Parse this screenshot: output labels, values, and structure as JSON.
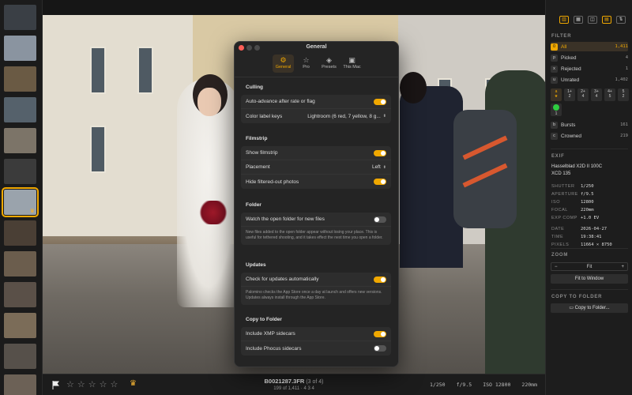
{
  "filmstrip": {
    "thumbs": [
      {
        "color": "#3a3f45"
      },
      {
        "color": "#8a94a0"
      },
      {
        "color": "#6a5a44"
      },
      {
        "color": "#55616b"
      },
      {
        "color": "#7c7468"
      },
      {
        "color": "#3b3b3b"
      },
      {
        "color": "#9aa3ac",
        "selected": true
      },
      {
        "color": "#4a3f35"
      },
      {
        "color": "#6b5d4d"
      },
      {
        "color": "#5a5048"
      },
      {
        "color": "#7b6c58"
      },
      {
        "color": "#56504a"
      },
      {
        "color": "#6c6156"
      }
    ]
  },
  "bottombar": {
    "filename": "B0021287.3FR",
    "position": "(3 of 4)",
    "count": "199 of 1,411",
    "counts_detail": "4   3   4",
    "shutter": "1/250",
    "aperture": "f/9.5",
    "iso": "ISO 12800",
    "focal": "220mm"
  },
  "sidebar": {
    "filter_title": "FILTER",
    "filters": [
      {
        "key": "0",
        "label": "All",
        "count": "1,411",
        "active": true
      },
      {
        "key": "p",
        "label": "Picked",
        "count": "4"
      },
      {
        "key": "x",
        "label": "Rejected",
        "count": "1"
      },
      {
        "key": "u",
        "label": "Unrated",
        "count": "1,402"
      }
    ],
    "ratings": [
      {
        "key": "a",
        "label": "★",
        "on": true
      },
      {
        "key": "1+",
        "label": "2"
      },
      {
        "key": "2+",
        "label": "4"
      },
      {
        "key": "3+",
        "label": "4"
      },
      {
        "key": "4+",
        "label": "5"
      },
      {
        "key": "5",
        "label": "2"
      }
    ],
    "color_filter": {
      "key": "1",
      "color": "#2ecc40"
    },
    "filters2": [
      {
        "key": "b",
        "label": "Bursts",
        "count": "161"
      },
      {
        "key": "c",
        "label": "Crowned",
        "count": "219"
      }
    ],
    "exif_title": "EXIF",
    "camera": "Hasselblad X2D II 100C",
    "lens": "XCD 135",
    "exif": [
      {
        "k": "SHUTTER",
        "v": "1/250"
      },
      {
        "k": "APERTURE",
        "v": "f/9.5"
      },
      {
        "k": "ISO",
        "v": "12800"
      },
      {
        "k": "FOCAL",
        "v": "220mm"
      },
      {
        "k": "EXP COMP",
        "v": "+1.0 EV"
      },
      {
        "k": "DATE",
        "v": "2026-04-27"
      },
      {
        "k": "TIME",
        "v": "19:38:41"
      },
      {
        "k": "PIXELS",
        "v": "11664 × 8750"
      }
    ],
    "zoom_title": "ZOOM",
    "zoom_value": "Fit",
    "fit_window": "Fit to Window",
    "copy_title": "COPY TO FOLDER",
    "copy_button": "Copy to Folder..."
  },
  "dialog": {
    "title": "General",
    "tabs": [
      {
        "label": "General",
        "icon": "⚙",
        "on": true
      },
      {
        "label": "Pro",
        "icon": "☆"
      },
      {
        "label": "Presets",
        "icon": "◈"
      },
      {
        "label": "This Mac",
        "icon": "▣"
      }
    ],
    "culling": {
      "title": "Culling",
      "auto_advance": "Auto-advance after rate or flag",
      "color_keys": "Color label keys",
      "color_keys_value": "Lightroom (6 red, 7 yellow, 8 g..."
    },
    "filmstrip": {
      "title": "Filmstrip",
      "show": "Show filmstrip",
      "placement": "Placement",
      "placement_value": "Left",
      "hide_filtered": "Hide filtered-out photos"
    },
    "folder": {
      "title": "Folder",
      "watch": "Watch the open folder for new files",
      "note": "New files added to the open folder appear without losing your place. This is useful for tethered shooting, and it takes effect the next time you open a folder."
    },
    "updates": {
      "title": "Updates",
      "check": "Check for updates automatically",
      "note": "Palomino checks the App Store once a day at launch and offers new versions. Updates always install through the App Store."
    },
    "copy": {
      "title": "Copy to Folder",
      "xmp": "Include XMP sidecars",
      "phocus": "Include Phocus sidecars"
    }
  }
}
